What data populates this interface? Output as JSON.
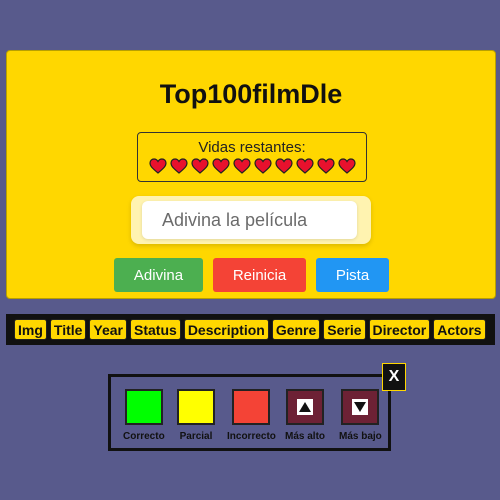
{
  "app": {
    "title": "Top100filmDle"
  },
  "lives": {
    "label": "Vidas restantes:",
    "count": 10,
    "heart_color": "#e8112d"
  },
  "search": {
    "placeholder": "Adivina la película"
  },
  "buttons": {
    "guess": "Adivina",
    "reset": "Reinicia",
    "hint": "Pista"
  },
  "columns": [
    "Img",
    "Title",
    "Year",
    "Status",
    "Description",
    "Genre",
    "Serie",
    "Director",
    "Actors"
  ],
  "legend": {
    "close": "X",
    "items": [
      {
        "label": "Correcto",
        "color": "#00ff00",
        "icon": ""
      },
      {
        "label": "Parcial",
        "color": "#ffff00",
        "icon": ""
      },
      {
        "label": "Incorrecto",
        "color": "#f44336",
        "icon": ""
      },
      {
        "label": "Más alto",
        "color": "#6d2135",
        "icon": "arrow-up-icon"
      },
      {
        "label": "Más bajo",
        "color": "#6d2135",
        "icon": "arrow-down-icon"
      }
    ]
  }
}
